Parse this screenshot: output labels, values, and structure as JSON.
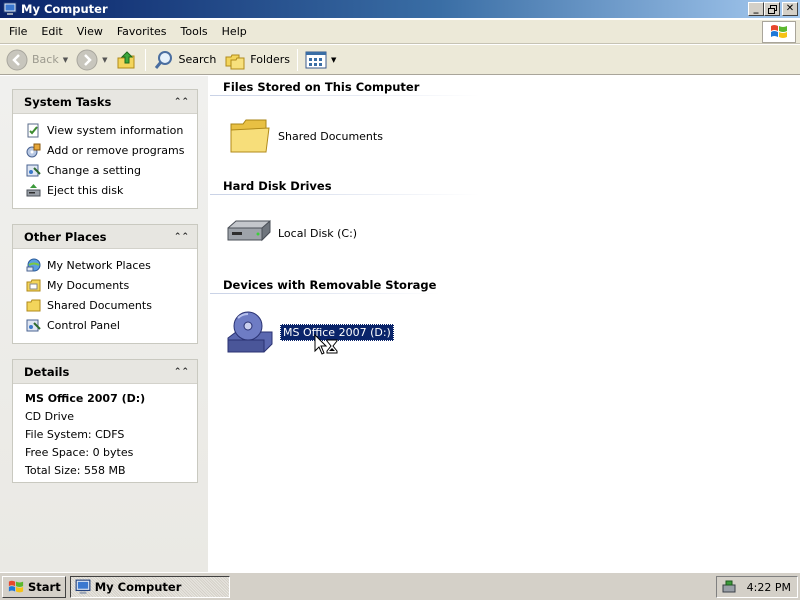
{
  "window": {
    "title": "My Computer"
  },
  "caption_buttons": [
    "minimize",
    "restore",
    "close"
  ],
  "menu": [
    "File",
    "Edit",
    "View",
    "Favorites",
    "Tools",
    "Help"
  ],
  "toolbar": {
    "back_label": "Back",
    "search_label": "Search",
    "folders_label": "Folders"
  },
  "system_tasks": {
    "title": "System Tasks",
    "items": [
      {
        "label": "View system information",
        "icon": "system-info-icon"
      },
      {
        "label": "Add or remove programs",
        "icon": "add-remove-programs-icon"
      },
      {
        "label": "Change a setting",
        "icon": "control-panel-icon"
      },
      {
        "label": "Eject this disk",
        "icon": "eject-icon"
      }
    ]
  },
  "other_places": {
    "title": "Other Places",
    "items": [
      {
        "label": "My Network Places",
        "icon": "network-places-icon"
      },
      {
        "label": "My Documents",
        "icon": "my-documents-icon"
      },
      {
        "label": "Shared Documents",
        "icon": "shared-documents-icon"
      },
      {
        "label": "Control Panel",
        "icon": "control-panel-icon"
      }
    ]
  },
  "details": {
    "title": "Details",
    "name": "MS Office 2007 (D:)",
    "type": "CD Drive",
    "file_system": "File System: CDFS",
    "free_space": "Free Space: 0 bytes",
    "total_size": "Total Size: 558 MB"
  },
  "main": {
    "sections": [
      {
        "title": "Files Stored on This Computer",
        "items": [
          {
            "label": "Shared Documents",
            "icon": "folder-icon"
          }
        ]
      },
      {
        "title": "Hard Disk Drives",
        "items": [
          {
            "label": "Local Disk (C:)",
            "icon": "hard-disk-icon"
          }
        ]
      },
      {
        "title": "Devices with Removable Storage",
        "items": [
          {
            "label": "MS Office 2007 (D:)",
            "icon": "cd-drive-icon",
            "selected": true
          }
        ]
      }
    ]
  },
  "taskbar": {
    "start_label": "Start",
    "task_label": "My Computer",
    "clock": "4:22 PM"
  },
  "colors": {
    "title_bar": "#0a246a",
    "selection": "#0a246a",
    "panel_bg": "#ece9d8"
  }
}
